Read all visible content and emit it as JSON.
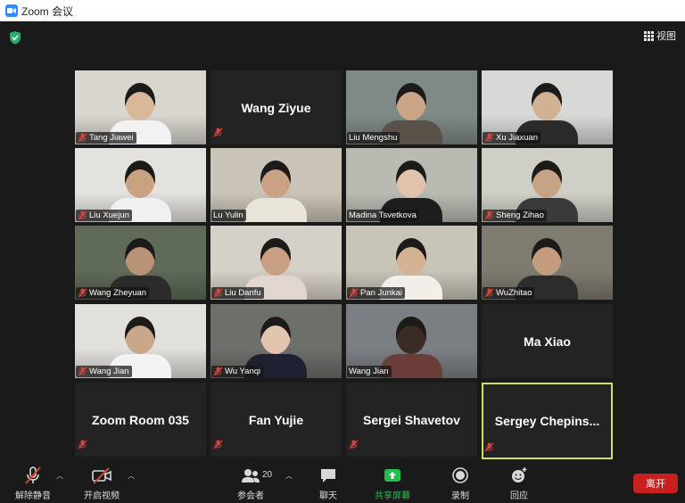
{
  "window": {
    "title": "Zoom 会议"
  },
  "header": {
    "view_label": "视图"
  },
  "tiles": [
    {
      "name": "Tang Jiawei",
      "muted": true,
      "video": true,
      "bg": "#d9d6cf",
      "skin": "#d9b89a",
      "shirt": "#f2f2f2"
    },
    {
      "name": "Wang Ziyue",
      "muted": true,
      "video": false
    },
    {
      "name": "Liu Mengshu",
      "muted": false,
      "video": true,
      "bg": "#7f8a86",
      "skin": "#c9a585",
      "shirt": "#5a5248"
    },
    {
      "name": "Xu Jiaxuan",
      "muted": true,
      "video": true,
      "bg": "#d7d9d6",
      "skin": "#d1b191",
      "shirt": "#2a2a2a"
    },
    {
      "name": "Liu Xuejun",
      "muted": true,
      "video": true,
      "bg": "#e4e2de",
      "skin": "#c9a282",
      "shirt": "#f0f0f0"
    },
    {
      "name": "Lu Yulin",
      "muted": false,
      "video": true,
      "bg": "#c9c3b8",
      "skin": "#caa183",
      "shirt": "#e9e4da"
    },
    {
      "name": "Madina Tsvetkova",
      "muted": false,
      "video": true,
      "bg": "#b9bbb3",
      "skin": "#e0c2ad",
      "shirt": "#1e1e1e"
    },
    {
      "name": "Sheng Zihao",
      "muted": true,
      "video": true,
      "bg": "#cfcfc7",
      "skin": "#c6a385",
      "shirt": "#3a3a3a"
    },
    {
      "name": "Wang Zheyuan",
      "muted": true,
      "video": true,
      "bg": "#5f6a58",
      "skin": "#b89376",
      "shirt": "#2b2b2b"
    },
    {
      "name": "Liu Danfu",
      "muted": true,
      "video": true,
      "bg": "#d6d1c8",
      "skin": "#c89f82",
      "shirt": "#e2d6d0"
    },
    {
      "name": "Pan Junkai",
      "muted": true,
      "video": true,
      "bg": "#c8c4b8",
      "skin": "#d4b394",
      "shirt": "#f2efe8"
    },
    {
      "name": "WuZhitao",
      "muted": true,
      "video": true,
      "bg": "#7e7b70",
      "skin": "#c29c7d",
      "shirt": "#2c2c2c"
    },
    {
      "name": "Wang Jian",
      "muted": true,
      "video": true,
      "bg": "#e2e0db",
      "skin": "#c9a789",
      "shirt": "#f3f3f3"
    },
    {
      "name": "Wu Yanqi",
      "muted": true,
      "video": true,
      "bg": "#6e6f6b",
      "skin": "#e2c5ae",
      "shirt": "#1c2030"
    },
    {
      "name": "Wang Jian",
      "muted": false,
      "video": true,
      "bg": "#7b7f84",
      "skin": "#3a2c24",
      "shirt": "#6a3e38"
    },
    {
      "name": "Ma Xiao",
      "muted": false,
      "video": false
    },
    {
      "name": "Zoom Room 035",
      "muted": true,
      "video": false
    },
    {
      "name": "Fan Yujie",
      "muted": true,
      "video": false
    },
    {
      "name": "Sergei Shavetov",
      "muted": true,
      "video": false
    },
    {
      "name": "Sergey  Chepins...",
      "muted": true,
      "video": false,
      "active": true
    }
  ],
  "toolbar": {
    "unmute_label": "解除静音",
    "start_video_label": "开启视频",
    "participants_label": "参会者",
    "participants_count": "20",
    "chat_label": "聊天",
    "share_label": "共享屏幕",
    "record_label": "录制",
    "reactions_label": "回应",
    "leave_label": "离开"
  },
  "colors": {
    "share_green": "#1fc24b",
    "leave_red": "#c9201f",
    "active_border": "#cfe25b",
    "mute_red": "#e0403a"
  }
}
